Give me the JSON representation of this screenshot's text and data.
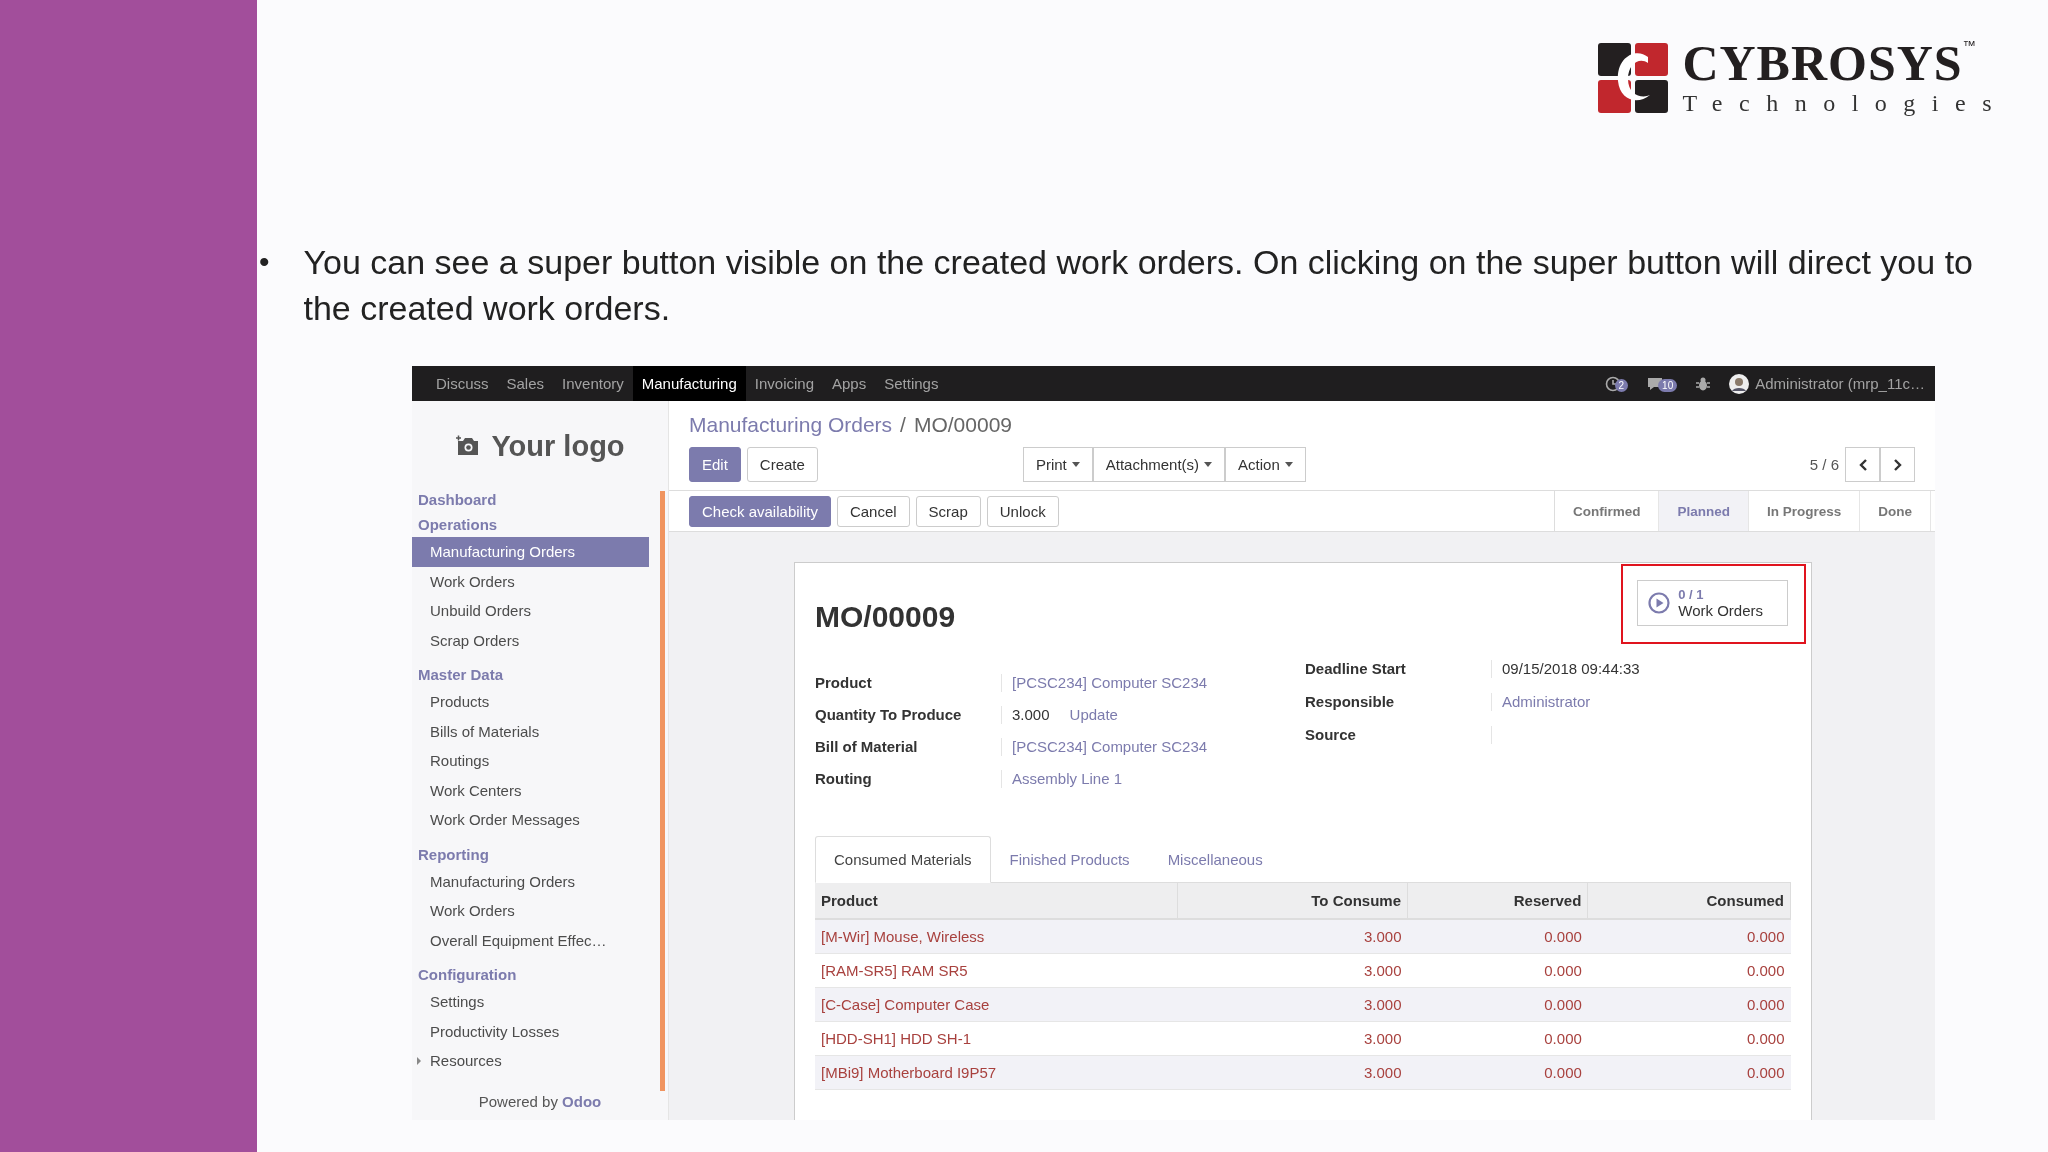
{
  "logo": {
    "name": "CYBROSYS",
    "tm": "™",
    "tagline": "Technologies"
  },
  "slide": {
    "bullet": "•",
    "text": "You can see a super button visible on the created work orders. On clicking on the super button will direct you to the created work orders."
  },
  "app": {
    "top_menu": [
      {
        "label": "Discuss",
        "selected": false
      },
      {
        "label": "Sales",
        "selected": false
      },
      {
        "label": "Inventory",
        "selected": false
      },
      {
        "label": "Manufacturing",
        "selected": true
      },
      {
        "label": "Invoicing",
        "selected": false
      },
      {
        "label": "Apps",
        "selected": false
      },
      {
        "label": "Settings",
        "selected": false
      }
    ],
    "systray": {
      "activity_count": "2",
      "message_count": "10",
      "user": "Administrator (mrp_11c…"
    },
    "sidebar": {
      "logo_text": "Your logo",
      "sections": [
        {
          "title": "Dashboard"
        },
        {
          "title": "Operations",
          "items": [
            {
              "label": "Manufacturing Orders",
              "selected": true,
              "kind": "item"
            },
            {
              "label": "Work Orders",
              "selected": false,
              "kind": "item"
            },
            {
              "label": "Unbuild Orders",
              "selected": false,
              "kind": "item"
            },
            {
              "label": "Scrap Orders",
              "selected": false,
              "kind": "item"
            }
          ]
        },
        {
          "title": "Master Data",
          "items": [
            {
              "label": "Products",
              "selected": false,
              "kind": "item"
            },
            {
              "label": "Bills of Materials",
              "selected": false,
              "kind": "item"
            },
            {
              "label": "Routings",
              "selected": false,
              "kind": "item"
            },
            {
              "label": "Work Centers",
              "selected": false,
              "kind": "item"
            },
            {
              "label": "Work Order Messages",
              "selected": false,
              "kind": "item"
            }
          ]
        },
        {
          "title": "Reporting",
          "items": [
            {
              "label": "Manufacturing Orders",
              "selected": false,
              "kind": "item"
            },
            {
              "label": "Work Orders",
              "selected": false,
              "kind": "item"
            },
            {
              "label": "Overall Equipment Effec…",
              "selected": false,
              "kind": "item"
            }
          ]
        },
        {
          "title": "Configuration",
          "items": [
            {
              "label": "Settings",
              "selected": false,
              "kind": "item"
            },
            {
              "label": "Productivity Losses",
              "selected": false,
              "kind": "item"
            },
            {
              "label": "Resources",
              "selected": false,
              "kind": "folder",
              "expanded": false
            }
          ]
        }
      ],
      "footer_prefix": "Powered by",
      "footer_brand": "Odoo"
    },
    "breadcrumb": {
      "parent": "Manufacturing Orders",
      "separator": "/",
      "current": "MO/00009"
    },
    "buttons": [
      {
        "label": "Edit",
        "primary": true
      },
      {
        "label": "Create",
        "primary": false
      }
    ],
    "dropdowns": [
      "Print",
      "Attachment(s)",
      "Action"
    ],
    "pager": "5 / 6",
    "header_buttons": [
      {
        "label": "Check availability",
        "primary": true
      },
      {
        "label": "Cancel",
        "primary": false
      },
      {
        "label": "Scrap",
        "primary": false
      },
      {
        "label": "Unlock",
        "primary": false
      }
    ],
    "statusbar": [
      {
        "label": "Confirmed",
        "selected": false
      },
      {
        "label": "Planned",
        "selected": true
      },
      {
        "label": "In Progress",
        "selected": false
      },
      {
        "label": "Done",
        "selected": false
      }
    ],
    "record": {
      "title": "MO/00009",
      "smart_button": {
        "count": "0 / 1",
        "label": "Work Orders",
        "highlighted": true
      },
      "left_fields": [
        {
          "label": "Product",
          "value": "[PCSC234] Computer SC234",
          "kind": "link"
        },
        {
          "label": "Quantity To Produce",
          "value": "3.000",
          "action": "Update",
          "kind": "text"
        },
        {
          "label": "Bill of Material",
          "value": "[PCSC234] Computer SC234",
          "kind": "link"
        },
        {
          "label": "Routing",
          "value": "Assembly Line 1",
          "kind": "link"
        }
      ],
      "right_fields": [
        {
          "label": "Deadline Start",
          "value": "09/15/2018 09:44:33",
          "kind": "text"
        },
        {
          "label": "Responsible",
          "value": "Administrator",
          "kind": "link"
        },
        {
          "label": "Source"
        }
      ]
    },
    "notebook": {
      "tabs": [
        {
          "label": "Consumed Materials",
          "selected": true
        },
        {
          "label": "Finished Products",
          "selected": false
        },
        {
          "label": "Miscellaneous",
          "selected": false
        }
      ],
      "table": {
        "columns": [
          "Product",
          "To Consume",
          "Reserved",
          "Consumed"
        ],
        "rows": [
          [
            "[M-Wir] Mouse, Wireless",
            "3.000",
            "0.000",
            "0.000"
          ],
          [
            "[RAM-SR5] RAM SR5",
            "3.000",
            "0.000",
            "0.000"
          ],
          [
            "[C-Case] Computer Case",
            "3.000",
            "0.000",
            "0.000"
          ],
          [
            "[HDD-SH1] HDD SH-1",
            "3.000",
            "0.000",
            "0.000"
          ],
          [
            "[MBi9] Motherboard I9P57",
            "3.000",
            "0.000",
            "0.000"
          ]
        ]
      }
    }
  }
}
